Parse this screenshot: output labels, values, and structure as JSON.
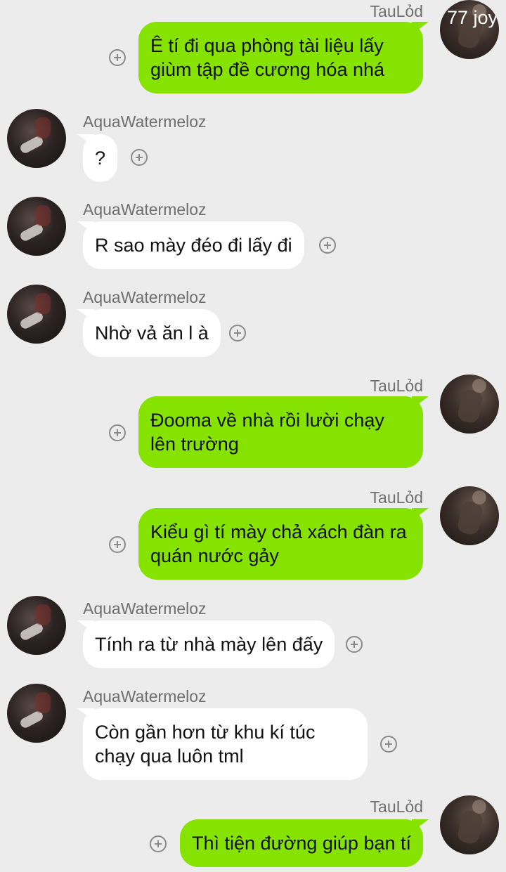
{
  "colors": {
    "background": "#ececec",
    "outgoing_bubble": "#86e300",
    "incoming_bubble": "#ffffff",
    "sender_name": "#6f6f6f"
  },
  "icons": {
    "add_reaction": "add-reaction-icon"
  },
  "avatar_overlay_text": "77 joy",
  "messages": [
    {
      "sender": "TauLỏd",
      "text": "Ê tí đi qua phòng tài liệu lấy giùm tập đề cương hóa nhá",
      "direction": "out"
    },
    {
      "sender": "AquaWatermeloz",
      "text": "?",
      "direction": "in"
    },
    {
      "sender": "AquaWatermeloz",
      "text": "R sao mày đéo đi lấy đi",
      "direction": "in"
    },
    {
      "sender": "AquaWatermeloz",
      "text": "Nhờ vả ăn l à",
      "direction": "in"
    },
    {
      "sender": "TauLỏd",
      "text": "Đooma về nhà rồi lười chạy lên trường",
      "direction": "out"
    },
    {
      "sender": "TauLỏd",
      "text": "Kiểu gì tí mày chả xách đàn ra quán nước gảy",
      "direction": "out"
    },
    {
      "sender": "AquaWatermeloz",
      "text": "Tính ra từ nhà mày lên đấy",
      "direction": "in"
    },
    {
      "sender": "AquaWatermeloz",
      "text": "Còn gần hơn từ khu kí túc chạy qua luôn tml",
      "direction": "in"
    },
    {
      "sender": "TauLỏd",
      "text": "Thì tiện đường giúp bạn tí",
      "direction": "out"
    }
  ]
}
